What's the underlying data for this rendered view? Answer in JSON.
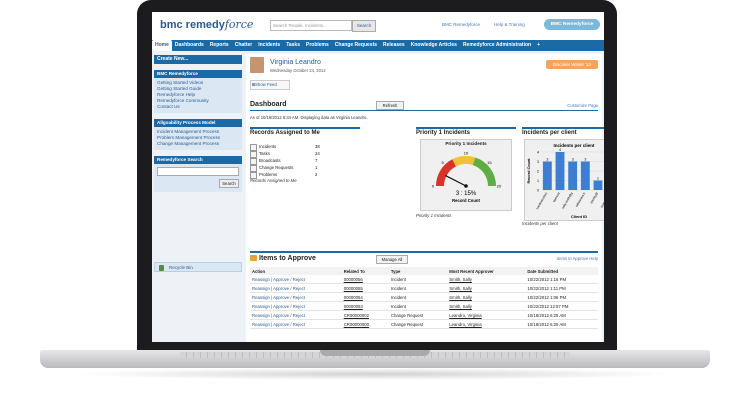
{
  "header": {
    "logo_prefix": "bmc remedy",
    "logo_suffix": "force",
    "search_placeholder": "Search People, Incidents...",
    "search_button": "Search",
    "link_remedyforce": "BMC Remedyforce",
    "link_help": "Help & Training",
    "app_pill": "BMC Remedyforce"
  },
  "tabs": [
    "Home",
    "Dashboards",
    "Reports",
    "Chatter",
    "Incidents",
    "Tasks",
    "Problems",
    "Change Requests",
    "Releases",
    "Knowledge Articles",
    "Remedyforce Administration",
    "+"
  ],
  "sidebar": {
    "create_new": "Create New...",
    "bmc_title": "BMC Remedyforce",
    "bmc_items": [
      "Getting Started Videos",
      "Getting Started Guide",
      "Remedyforce Help",
      "Remedyforce Community",
      "Contact Us"
    ],
    "process_title": "Allgoability Process Model",
    "process_items": [
      "Incident Management Process",
      "Problem Management Process",
      "Change Management Process"
    ],
    "search_title": "Remedyforce Search",
    "search_button": "Search",
    "recycle": "Recycle Bin"
  },
  "user": {
    "name": "Virginia Leandro",
    "date": "Wednesday October 24, 2012",
    "discover": "Discover Winter '13",
    "show_feed": "Show Feed"
  },
  "dashboard": {
    "title": "Dashboard",
    "refresh": "Refresh",
    "customize": "Customize Page",
    "as_of": "As of 10/19/2012 6:34 AM. Displaying data as Virginia Leandro."
  },
  "records": {
    "title": "Records Assigned to Me",
    "rows": [
      {
        "label": "Incidents",
        "value": "38"
      },
      {
        "label": "Tasks",
        "value": "24"
      },
      {
        "label": "Broadcasts",
        "value": "7"
      },
      {
        "label": "Change Requests",
        "value": "1"
      },
      {
        "label": "Problems",
        "value": "2"
      }
    ],
    "footer": "Records Assigned to Me"
  },
  "priority": {
    "title": "Priority 1 Incidents",
    "chart_title": "Priority 1 Incidents",
    "readout": "3 : 15%",
    "label": "Record Count",
    "ticks": [
      "0",
      "5",
      "10",
      "15",
      "20"
    ],
    "footer": "Priority 1 Incidents"
  },
  "perclient": {
    "title": "Incidents per client",
    "footer": "Incidents per client"
  },
  "chart_data": [
    {
      "type": "gauge",
      "title": "Priority 1 Incidents",
      "value": 3,
      "min": 0,
      "max": 20,
      "ticks": [
        0,
        5,
        10,
        15,
        20
      ],
      "band_colors": [
        "#d9342b",
        "#f2c13a",
        "#5fae44"
      ]
    },
    {
      "type": "bar",
      "title": "Incidents per client",
      "ylabel": "Record Count",
      "xlabel": "Client ID",
      "categories": [
        "hacilindustries",
        "fairmont",
        "sally.smith@g",
        "wilhelmina.h",
        "stanley@",
        "support.apex"
      ],
      "values": [
        3,
        4,
        3,
        3,
        1,
        2
      ],
      "ylim": [
        0,
        4
      ],
      "bar_color": "#3d7ed1"
    }
  ],
  "approvals": {
    "title": "Items to Approve",
    "manage": "Manage All",
    "help": "Items to Approve Help",
    "columns": [
      "Action",
      "Related To",
      "Type",
      "Most Recent Approver",
      "Date Submitted"
    ],
    "rows": [
      {
        "action": "Reassign | Approve / Reject",
        "related": "00000056",
        "type": "Incident",
        "approver": "Smith, Sally",
        "date": "10/22/2012 1:16 PM"
      },
      {
        "action": "Reassign | Approve / Reject",
        "related": "00000055",
        "type": "Incident",
        "approver": "Smith, Sally",
        "date": "10/22/2012 1:11 PM"
      },
      {
        "action": "Reassign | Approve / Reject",
        "related": "00000054",
        "type": "Incident",
        "approver": "Smith, Sally",
        "date": "10/22/2012 1:06 PM"
      },
      {
        "action": "Reassign | Approve / Reject",
        "related": "00000053",
        "type": "Incident",
        "approver": "Smith, Sally",
        "date": "10/22/2012 12:57 PM"
      },
      {
        "action": "Reassign | Approve / Reject",
        "related": "CR00000002",
        "type": "Change Request",
        "approver": "Leandro, Virginia",
        "date": "10/18/2012 6:25 AM"
      },
      {
        "action": "Reassign | Approve / Reject",
        "related": "CR00000000",
        "type": "Change Request",
        "approver": "Leandro, Virginia",
        "date": "10/18/2012 6:25 AM"
      }
    ]
  }
}
